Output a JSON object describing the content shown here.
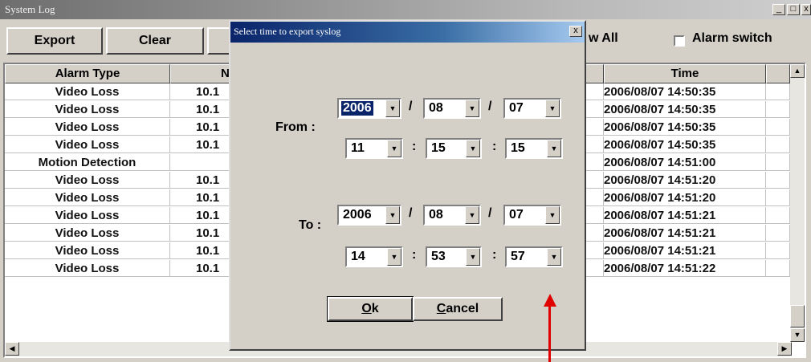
{
  "window": {
    "title": "System Log"
  },
  "toolbar": {
    "export_label": "Export",
    "clear_label": "Clear",
    "view_all_label": "w All",
    "alarm_switch_label": "Alarm switch"
  },
  "table": {
    "headers": [
      "Alarm Type",
      "N",
      "Time"
    ],
    "rows": [
      {
        "type": "Video Loss",
        "ip": "10.1",
        "time": "2006/08/07 14:50:35"
      },
      {
        "type": "Video Loss",
        "ip": "10.1",
        "time": "2006/08/07 14:50:35"
      },
      {
        "type": "Video Loss",
        "ip": "10.1",
        "time": "2006/08/07 14:50:35"
      },
      {
        "type": "Video Loss",
        "ip": "10.1",
        "time": "2006/08/07 14:50:35"
      },
      {
        "type": "Motion Detection",
        "ip": "",
        "time": "2006/08/07 14:51:00"
      },
      {
        "type": "Video Loss",
        "ip": "10.1",
        "time": "2006/08/07 14:51:20"
      },
      {
        "type": "Video Loss",
        "ip": "10.1",
        "time": "2006/08/07 14:51:20"
      },
      {
        "type": "Video Loss",
        "ip": "10.1",
        "time": "2006/08/07 14:51:21"
      },
      {
        "type": "Video Loss",
        "ip": "10.1",
        "time": "2006/08/07 14:51:21"
      },
      {
        "type": "Video Loss",
        "ip": "10.1",
        "time": "2006/08/07 14:51:21"
      },
      {
        "type": "Video Loss",
        "ip": "10.1",
        "time": "2006/08/07 14:51:22"
      }
    ]
  },
  "dialog": {
    "title": "Select time to export syslog",
    "close_glyph": "x",
    "from_label": "From :",
    "to_label": "To :",
    "from": {
      "year": "2006",
      "month": "08",
      "day": "07",
      "hour": "11",
      "minute": "15",
      "second": "15"
    },
    "to": {
      "year": "2006",
      "month": "08",
      "day": "07",
      "hour": "14",
      "minute": "53",
      "second": "57"
    },
    "date_sep": "/",
    "time_sep": ":",
    "ok_label": "k",
    "ok_mnemonic": "O",
    "cancel_label": "ancel",
    "cancel_mnemonic": "C"
  },
  "colors": {
    "annotation_arrow": "#e00000",
    "dialog_title": "#0a246a"
  }
}
